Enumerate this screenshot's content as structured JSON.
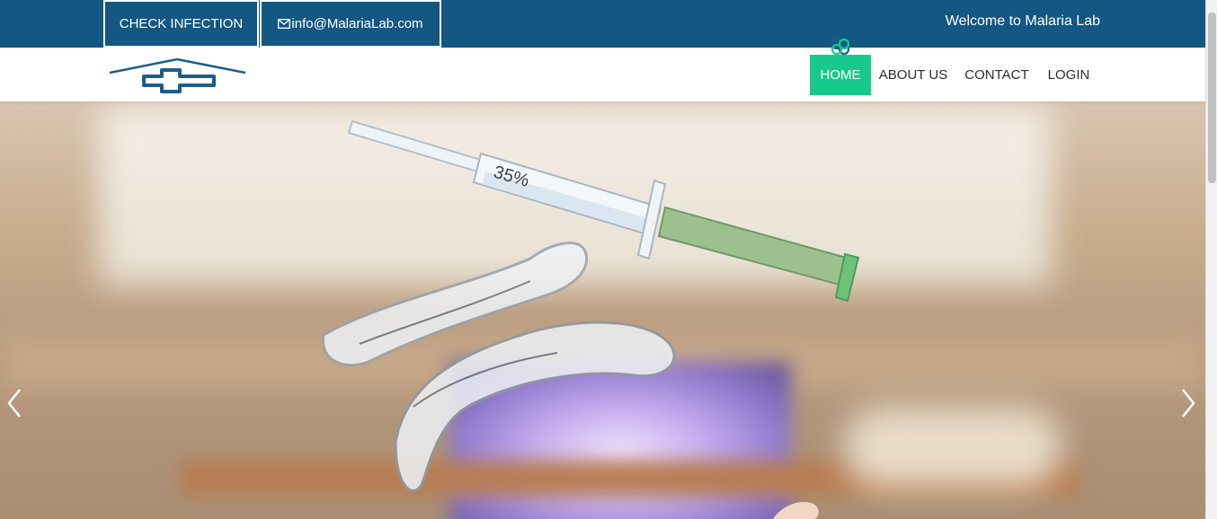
{
  "topbar": {
    "check_label": "CHECK INFECTION",
    "email_label": "info@MalariaLab.com",
    "welcome_text": "Welcome to Malaria Lab",
    "background_color": "#135782"
  },
  "nav": {
    "items": [
      {
        "label": "HOME",
        "active": true
      },
      {
        "label": "ABOUT US",
        "active": false
      },
      {
        "label": "CONTACT",
        "active": false
      },
      {
        "label": "LOGIN",
        "active": false
      }
    ],
    "active_color": "#19c98b"
  },
  "hero": {
    "syringe_label": "35%",
    "icons": [
      "chevron-left-icon",
      "chevron-right-icon"
    ]
  },
  "logo": {
    "icon": "hospital-cross-logo",
    "color": "#1d5d8a"
  }
}
